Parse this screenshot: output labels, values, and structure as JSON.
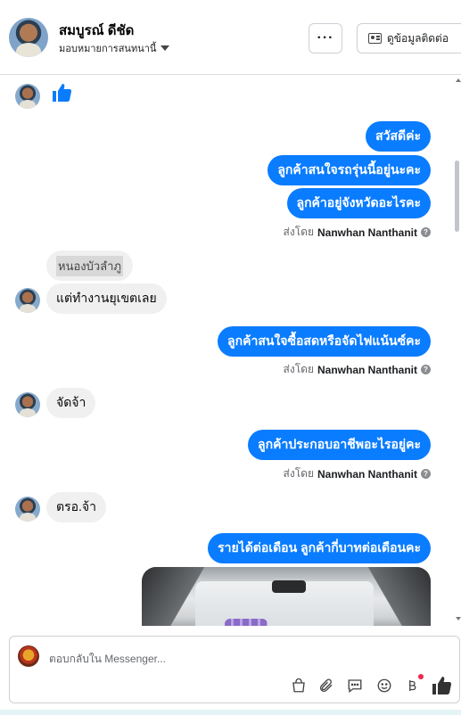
{
  "header": {
    "contact_name": "สมบูรณ์ ดีชัด",
    "assign_label": "มอบหมายการสนทนานี้",
    "more_label": "···",
    "contact_info_label": "ดูข้อมูลติดต่อ"
  },
  "messages": [
    {
      "type": "in-like"
    },
    {
      "type": "out",
      "text": "สวัสดีค่ะ"
    },
    {
      "type": "out",
      "text": "ลูกค้าสนใจรถรุ่นนี้อยู่นะคะ"
    },
    {
      "type": "out",
      "text": "ลูกค้าอยู่จังหวัดอะไรคะ"
    },
    {
      "type": "sent-by",
      "prefix": "ส่งโดย",
      "agent": "Nanwhan Nanthanit"
    },
    {
      "type": "in-quote",
      "text": "หนองบัวลำภู"
    },
    {
      "type": "in",
      "text": "แต่ทำงานยุเขตเลย"
    },
    {
      "type": "out",
      "text": "ลูกค้าสนใจซื้อสดหรือจัดไฟแน้นซ์คะ"
    },
    {
      "type": "sent-by",
      "prefix": "ส่งโดย",
      "agent": "Nanwhan Nanthanit"
    },
    {
      "type": "in",
      "text": "จัดจ้า"
    },
    {
      "type": "out",
      "text": "ลูกค้าประกอบอาชีพอะไรอยู่คะ"
    },
    {
      "type": "sent-by",
      "prefix": "ส่งโดย",
      "agent": "Nanwhan Nanthanit"
    },
    {
      "type": "in",
      "text": "ตรอ.จ้า"
    },
    {
      "type": "out",
      "text": "รายได้ต่อเดือน ลูกค้ากี่บาทต่อเดือนคะ"
    },
    {
      "type": "out-photo",
      "description": "car interior photo"
    }
  ],
  "composer": {
    "placeholder": "ตอบกลับใน Messenger..."
  },
  "toolbar_icons": [
    "bag-icon",
    "paperclip-icon",
    "saved-reply-icon",
    "emoji-icon",
    "payment-icon",
    "like-icon"
  ],
  "colors": {
    "outgoing_bubble": "#0a7cff",
    "incoming_bubble": "#f0f0f0",
    "notify_dot": "#f02849"
  }
}
